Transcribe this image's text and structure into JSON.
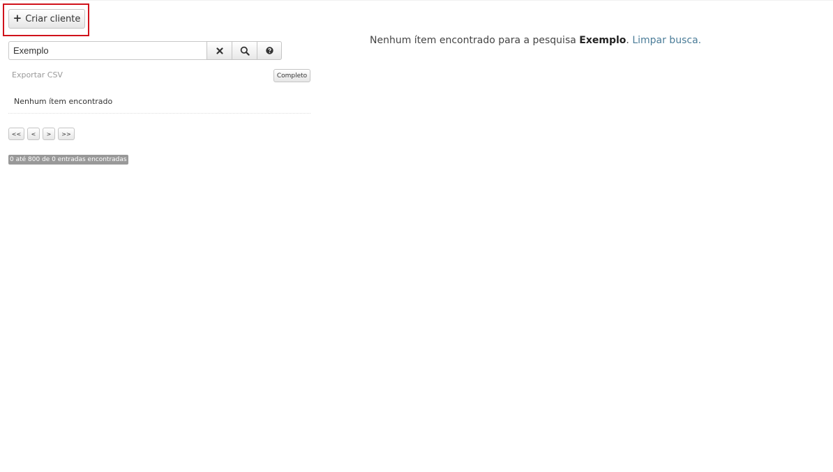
{
  "toolbar": {
    "create_label": "Criar cliente",
    "create_icon": "plus-icon"
  },
  "search": {
    "value": "Exemplo",
    "placeholder": "",
    "buttons": [
      "clear-icon",
      "search-icon",
      "help-icon"
    ]
  },
  "export": {
    "csv_label": "Exportar CSV",
    "full_label": "Completo"
  },
  "list": {
    "empty_text": "Nenhum ítem encontrado"
  },
  "pagination": {
    "first": "<<",
    "prev": "<",
    "next": ">",
    "last": ">>"
  },
  "summary": {
    "count_text": "0 até 800 de 0 entradas encontradas"
  },
  "results_message": {
    "prefix": "Nenhum ítem encontrado para a pesquisa ",
    "term": "Exemplo",
    "suffix": ".",
    "clear_link": "Limpar busca."
  },
  "colors": {
    "highlight": "#d0121b",
    "link": "#4a7c98",
    "badge": "#999999"
  }
}
